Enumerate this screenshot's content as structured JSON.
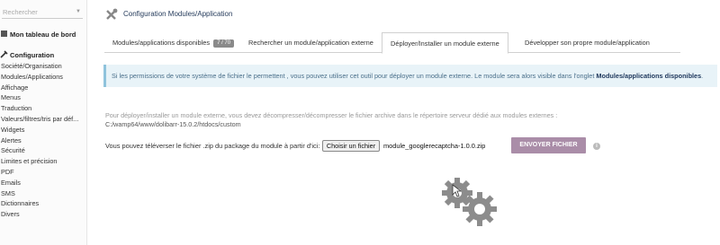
{
  "sidebar": {
    "search_placeholder": "Rechercher",
    "dashboard_label": "Mon tableau de bord",
    "section_label": "Configuration",
    "items": [
      {
        "label": "Société/Organisation"
      },
      {
        "label": "Modules/Applications"
      },
      {
        "label": "Affichage"
      },
      {
        "label": "Menus"
      },
      {
        "label": "Traduction"
      },
      {
        "label": "Valeurs/filtres/tris par déf..."
      },
      {
        "label": "Widgets"
      },
      {
        "label": "Alertes"
      },
      {
        "label": "Sécurité"
      },
      {
        "label": "Limites et précision"
      },
      {
        "label": "PDF"
      },
      {
        "label": "Emails"
      },
      {
        "label": "SMS"
      },
      {
        "label": "Dictionnaires"
      },
      {
        "label": "Divers"
      }
    ]
  },
  "header": {
    "title": "Configuration Modules/Application"
  },
  "tabs": [
    {
      "label": "Modules/applications disponibles",
      "badge": "7 / 70"
    },
    {
      "label": "Rechercher un module/application externe"
    },
    {
      "label": "Déployer/Installer un module externe",
      "active": true
    },
    {
      "label": "Développer son propre module/application"
    }
  ],
  "info": {
    "text": "Si les permissions de votre système de fichier le permettent , vous pouvez utiliser cet outil pour déployer un module externe. Le module sera alors visible dans l'onglet ",
    "link": "Modules/applications disponibles",
    "suffix": "."
  },
  "deploy": {
    "hint": "Pour déployer/installer un module externe, vous devez décompresser/décompresser le fichier archive dans le répertoire serveur dédié aux modules externes :",
    "path": "C:/wamp64/www/dolibarr-15.0.2/htdocs/custom",
    "upload_label": "Vous pouvez téléverser le fichier .zip du package du module à partir d'ici:",
    "choose_file_label": "Choisir un fichier",
    "file_name": "module_googlerecaptcha-1.0.0.zip",
    "send_button": "ENVOYER FICHIER",
    "info_icon": "i"
  },
  "colors": {
    "accent": "#aa8da8",
    "title": "#263c5c",
    "info_bg": "#e8f3f8"
  },
  "icons": {
    "header": "tools-icon",
    "dashboard": "home-icon",
    "section": "wrench-icon",
    "loading": "gears-icon"
  }
}
